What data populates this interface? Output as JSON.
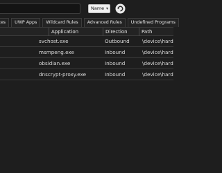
{
  "toolbar": {
    "search_value": "",
    "sort_label": "Name",
    "sort_chevron": "▾",
    "refresh_icon": "refresh-icon"
  },
  "tabs": [
    "vices",
    "UWP Apps",
    "Wildcard Rules",
    "Advanced Rules",
    "Undefined Programs"
  ],
  "table": {
    "headers": {
      "application": "Application",
      "direction": "Direction",
      "path": "Path"
    },
    "rows": [
      {
        "application": "svchost.exe",
        "direction": "Outbound",
        "path": "\\device\\harddi"
      },
      {
        "application": "msmpeng.exe",
        "direction": "Inbound",
        "path": "\\device\\harddi"
      },
      {
        "application": "obsidian.exe",
        "direction": "Inbound",
        "path": "\\device\\harddi"
      },
      {
        "application": "dnscrypt-proxy.exe",
        "direction": "Inbound",
        "path": "\\device\\harddi"
      }
    ]
  }
}
